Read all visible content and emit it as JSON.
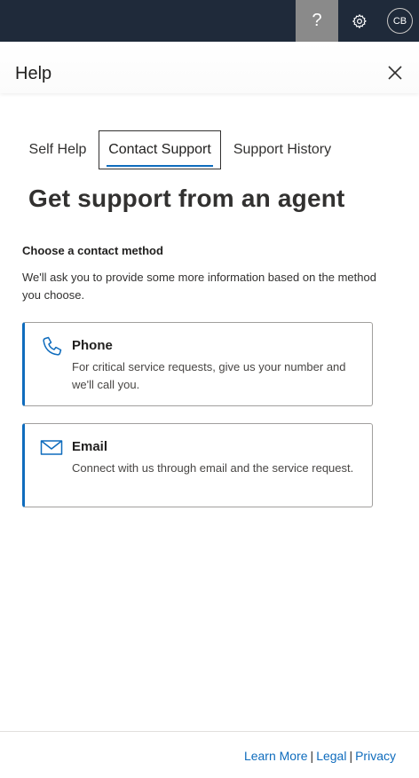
{
  "topbar": {
    "help_glyph": "?",
    "avatar_initials": "CB",
    "icons": [
      "question-icon",
      "gear-icon"
    ]
  },
  "panel": {
    "title": "Help"
  },
  "tabs": [
    {
      "label": "Self Help",
      "active": false
    },
    {
      "label": "Contact Support",
      "active": true
    },
    {
      "label": "Support History",
      "active": false
    }
  ],
  "main": {
    "heading": "Get support from an agent",
    "section_label": "Choose a contact method",
    "section_desc": "We'll ask you to provide some more information based on the method you choose."
  },
  "cards": [
    {
      "title": "Phone",
      "desc": "For critical service requests, give us your number and we'll call you.",
      "icon": "phone-icon"
    },
    {
      "title": "Email",
      "desc": "Connect with us through email and the service request.",
      "icon": "mail-icon"
    }
  ],
  "footer": {
    "links": [
      "Learn More",
      "Legal",
      "Privacy"
    ],
    "separator": "|"
  },
  "colors": {
    "accent": "#0f6cbd",
    "topbar": "#1f2a3a",
    "help_button_active": "#8a8a8a"
  }
}
